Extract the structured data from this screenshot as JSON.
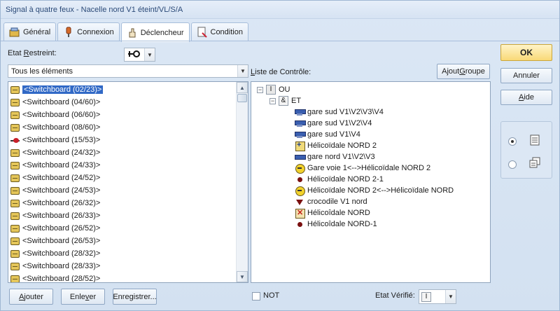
{
  "window": {
    "title": "Signal à quatre feux - Nacelle nord V1 éteint/VL/S/A"
  },
  "tabs": [
    {
      "label": "Général",
      "icon": "general-icon"
    },
    {
      "label": "Connexion",
      "icon": "connexion-icon"
    },
    {
      "label": "Déclencheur",
      "icon": "declencheur-icon"
    },
    {
      "label": "Condition",
      "icon": "condition-icon"
    }
  ],
  "etat_restreint": {
    "label_pre": "Etat ",
    "label_u": "R",
    "label_post": "estreint:",
    "value_icon": "switch-state-icon"
  },
  "filter": {
    "value": "Tous les éléments"
  },
  "left_list": {
    "items": [
      {
        "text": "<Switchboard (02/23)>",
        "icon": "switchboard-icon",
        "selected": true
      },
      {
        "text": "<Switchboard (04/60)>",
        "icon": "switchboard-icon"
      },
      {
        "text": "<Switchboard (06/60)>",
        "icon": "switchboard-icon"
      },
      {
        "text": "<Switchboard (08/60)>",
        "icon": "switchboard-icon"
      },
      {
        "text": "<Switchboard (15/53)>",
        "icon": "switch-red-icon"
      },
      {
        "text": "<Switchboard (24/32)>",
        "icon": "switchboard-icon"
      },
      {
        "text": "<Switchboard (24/33)>",
        "icon": "switchboard-icon"
      },
      {
        "text": "<Switchboard (24/52)>",
        "icon": "switchboard-icon"
      },
      {
        "text": "<Switchboard (24/53)>",
        "icon": "switchboard-icon"
      },
      {
        "text": "<Switchboard (26/32)>",
        "icon": "switchboard-icon"
      },
      {
        "text": "<Switchboard (26/33)>",
        "icon": "switchboard-icon"
      },
      {
        "text": "<Switchboard (26/52)>",
        "icon": "switchboard-icon"
      },
      {
        "text": "<Switchboard (26/53)>",
        "icon": "switchboard-icon"
      },
      {
        "text": "<Switchboard (28/32)>",
        "icon": "switchboard-icon"
      },
      {
        "text": "<Switchboard (28/33)>",
        "icon": "switchboard-icon"
      },
      {
        "text": "<Switchboard (28/52)>",
        "icon": "switchboard-icon"
      }
    ]
  },
  "control_list": {
    "label_u": "L",
    "label_rest": "iste de Contrôle:",
    "ajout_groupe_pre": "Ajout ",
    "ajout_groupe_u": "G",
    "ajout_groupe_post": "roupe",
    "root": {
      "expander": "−",
      "box": "I",
      "text": "OU"
    },
    "et": {
      "expander": "−",
      "box": "&",
      "text": "ET"
    },
    "children": [
      {
        "text": "gare sud V1\\V2\\V3\\V4",
        "icon": "signal"
      },
      {
        "text": "gare sud V1\\V2\\V4",
        "icon": "signal"
      },
      {
        "text": "gare sud V1\\V4",
        "icon": "signal"
      },
      {
        "text": "Hélicoïdale NORD 2",
        "icon": "heli"
      },
      {
        "text": "gare nord V1\\V2\\V3",
        "icon": "gare"
      },
      {
        "text": "Gare voie 1<-->Hélicoïdale NORD 2",
        "icon": "yellow"
      },
      {
        "text": "Hélicoïdale NORD 2-1",
        "icon": "dot"
      },
      {
        "text": "Hélicoïdale NORD 2<-->Hélicoïdale NORD",
        "icon": "yellow"
      },
      {
        "text": "crocodile V1 nord",
        "icon": "tri"
      },
      {
        "text": "Hélicoîdale NORD",
        "icon": "cross"
      },
      {
        "text": "Hélicoîdale NORD-1",
        "icon": "dot"
      }
    ]
  },
  "buttons": {
    "ok": "OK",
    "annuler": "Annuler",
    "aide_u": "A",
    "aide_rest": "ide",
    "ajouter_u": "A",
    "ajouter_rest": "jouter",
    "enlever_pre": "Enle",
    "enlever_u": "v",
    "enlever_post": "er",
    "enregistrer": "Enregistrer..."
  },
  "bottom": {
    "not_label": "NOT",
    "etat_verifie_label": "Etat Vérifié:",
    "etat_verifie_value": "I"
  },
  "view_options": [
    {
      "icon": "list-view-icon",
      "checked": true
    },
    {
      "icon": "copy-view-icon",
      "checked": false
    }
  ]
}
